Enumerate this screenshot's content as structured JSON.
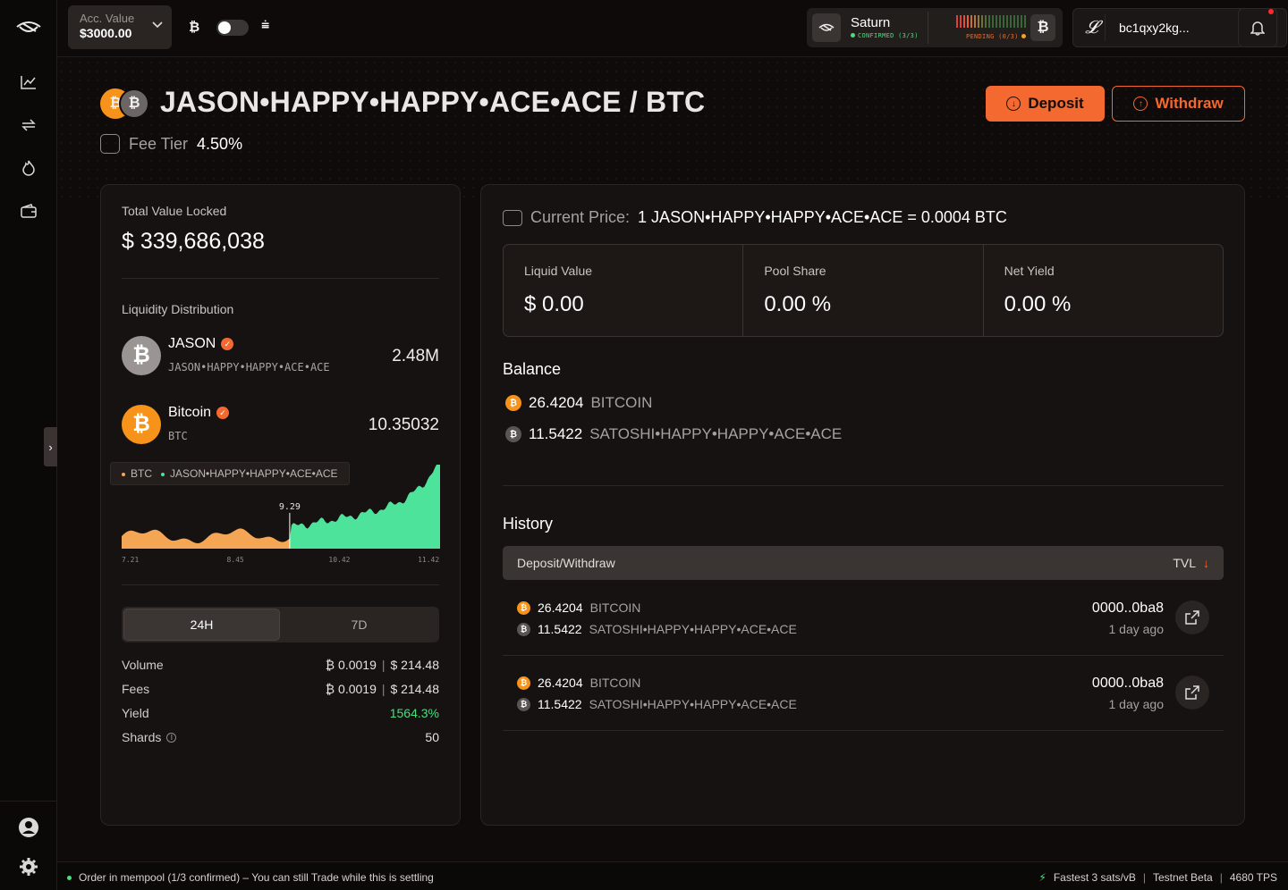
{
  "topbar": {
    "account_label": "Acc. Value",
    "account_value": "$3000.00",
    "btc_symbol": "₿",
    "rune_symbol": "⩧",
    "network_name": "Saturn",
    "confirmed_text": "CONFIRMED (3/3)",
    "pending_text": "PENDING (0/3)",
    "wallet_address": "bc1qxy2kg..."
  },
  "header": {
    "pair_title": "JASON•HAPPY•HAPPY•ACE•ACE / BTC",
    "fee_label": "Fee Tier",
    "fee_value": "4.50%",
    "deposit_label": "Deposit",
    "withdraw_label": "Withdraw"
  },
  "left": {
    "tvl_label": "Total Value Locked",
    "tvl_value": "$ 339,686,038",
    "dist_label": "Liquidity Distribution",
    "tokens": [
      {
        "name": "JASON",
        "sub": "JASON•HAPPY•HAPPY•ACE•ACE",
        "amount": "2.48M",
        "color": "#9a9593"
      },
      {
        "name": "Bitcoin",
        "sub": "BTC",
        "amount": "10.35032",
        "color": "#f7931a"
      }
    ],
    "legend": [
      "BTC",
      "JASON•HAPPY•HAPPY•ACE•ACE"
    ],
    "tabs": [
      "24H",
      "7D"
    ],
    "stats": [
      {
        "label": "Volume",
        "btc": "₿ 0.0019",
        "usd": "$ 214.48"
      },
      {
        "label": "Fees",
        "btc": "₿ 0.0019",
        "usd": "$ 214.48"
      }
    ],
    "yield_label": "Yield",
    "yield_value": "1564.3%",
    "shards_label": "Shards",
    "shards_value": "50"
  },
  "chart_data": {
    "type": "area",
    "series": [
      {
        "name": "BTC",
        "color": "#f5a654"
      },
      {
        "name": "JASON•HAPPY•HAPPY•ACE•ACE",
        "color": "#4ee39b"
      }
    ],
    "x_ticks": [
      "7.21",
      "8.45",
      "10.42",
      "11.42"
    ],
    "marker_label": "9.29",
    "split_fraction": 0.53
  },
  "right": {
    "price_label": "Current Price:",
    "price_value": "1 JASON•HAPPY•HAPPY•ACE•ACE = 0.0004 BTC",
    "metrics": [
      {
        "label": "Liquid Value",
        "value": "$ 0.00"
      },
      {
        "label": "Pool Share",
        "value": "0.00 %"
      },
      {
        "label": "Net Yield",
        "value": "0.00 %"
      }
    ],
    "balance_title": "Balance",
    "balances": [
      {
        "amount": "26.4204",
        "token": "BITCOIN"
      },
      {
        "amount": "11.5422",
        "token": "SATOSHI•HAPPY•HAPPY•ACE•ACE"
      }
    ],
    "history_title": "History",
    "history_col_left": "Deposit/Withdraw",
    "history_col_right": "TVL",
    "history": [
      {
        "btc_amount": "26.4204",
        "btc_token": "BITCOIN",
        "rune_amount": "11.5422",
        "rune_token": "SATOSHI•HAPPY•HAPPY•ACE•ACE",
        "tx": "0000..0ba8",
        "ago": "1 day ago"
      },
      {
        "btc_amount": "26.4204",
        "btc_token": "BITCOIN",
        "rune_amount": "11.5422",
        "rune_token": "SATOSHI•HAPPY•HAPPY•ACE•ACE",
        "tx": "0000..0ba8",
        "ago": "1 day ago"
      }
    ]
  },
  "footer": {
    "status": "Order in mempool (1/3 confirmed) – You can still Trade while this is settling",
    "fee_rate": "Fastest 3 sats/vB",
    "env": "Testnet Beta",
    "tps": "4680 TPS"
  }
}
